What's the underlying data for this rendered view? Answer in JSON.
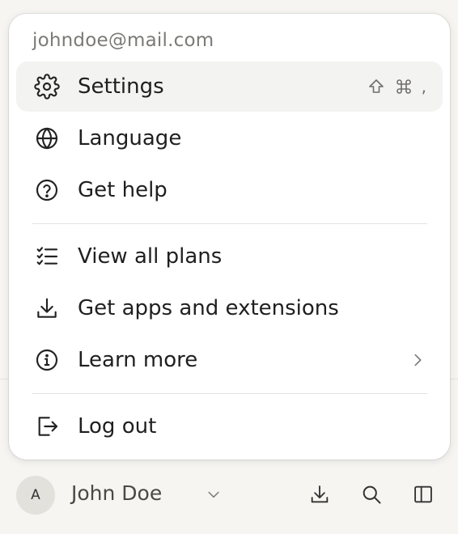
{
  "menu": {
    "account_email": "johndoe@mail.com",
    "items": [
      {
        "label": "Settings",
        "icon": "gear-icon",
        "shortcut": ","
      },
      {
        "label": "Language",
        "icon": "globe-icon"
      },
      {
        "label": "Get help",
        "icon": "help-circle-icon"
      },
      {
        "label": "View all plans",
        "icon": "checklist-icon"
      },
      {
        "label": "Get apps and extensions",
        "icon": "download-icon"
      },
      {
        "label": "Learn more",
        "icon": "info-icon"
      },
      {
        "label": "Log out",
        "icon": "logout-icon"
      }
    ]
  },
  "user": {
    "initial": "A",
    "name": "John Doe"
  },
  "toolbar": {
    "icons": [
      "download-icon",
      "search-icon",
      "sidebar-toggle-icon"
    ]
  },
  "colors": {
    "menu_bg": "#ffffff",
    "active_item_bg": "#f3f3f2",
    "page_bg": "#f6f5f2",
    "muted_text": "#7b7a76"
  }
}
